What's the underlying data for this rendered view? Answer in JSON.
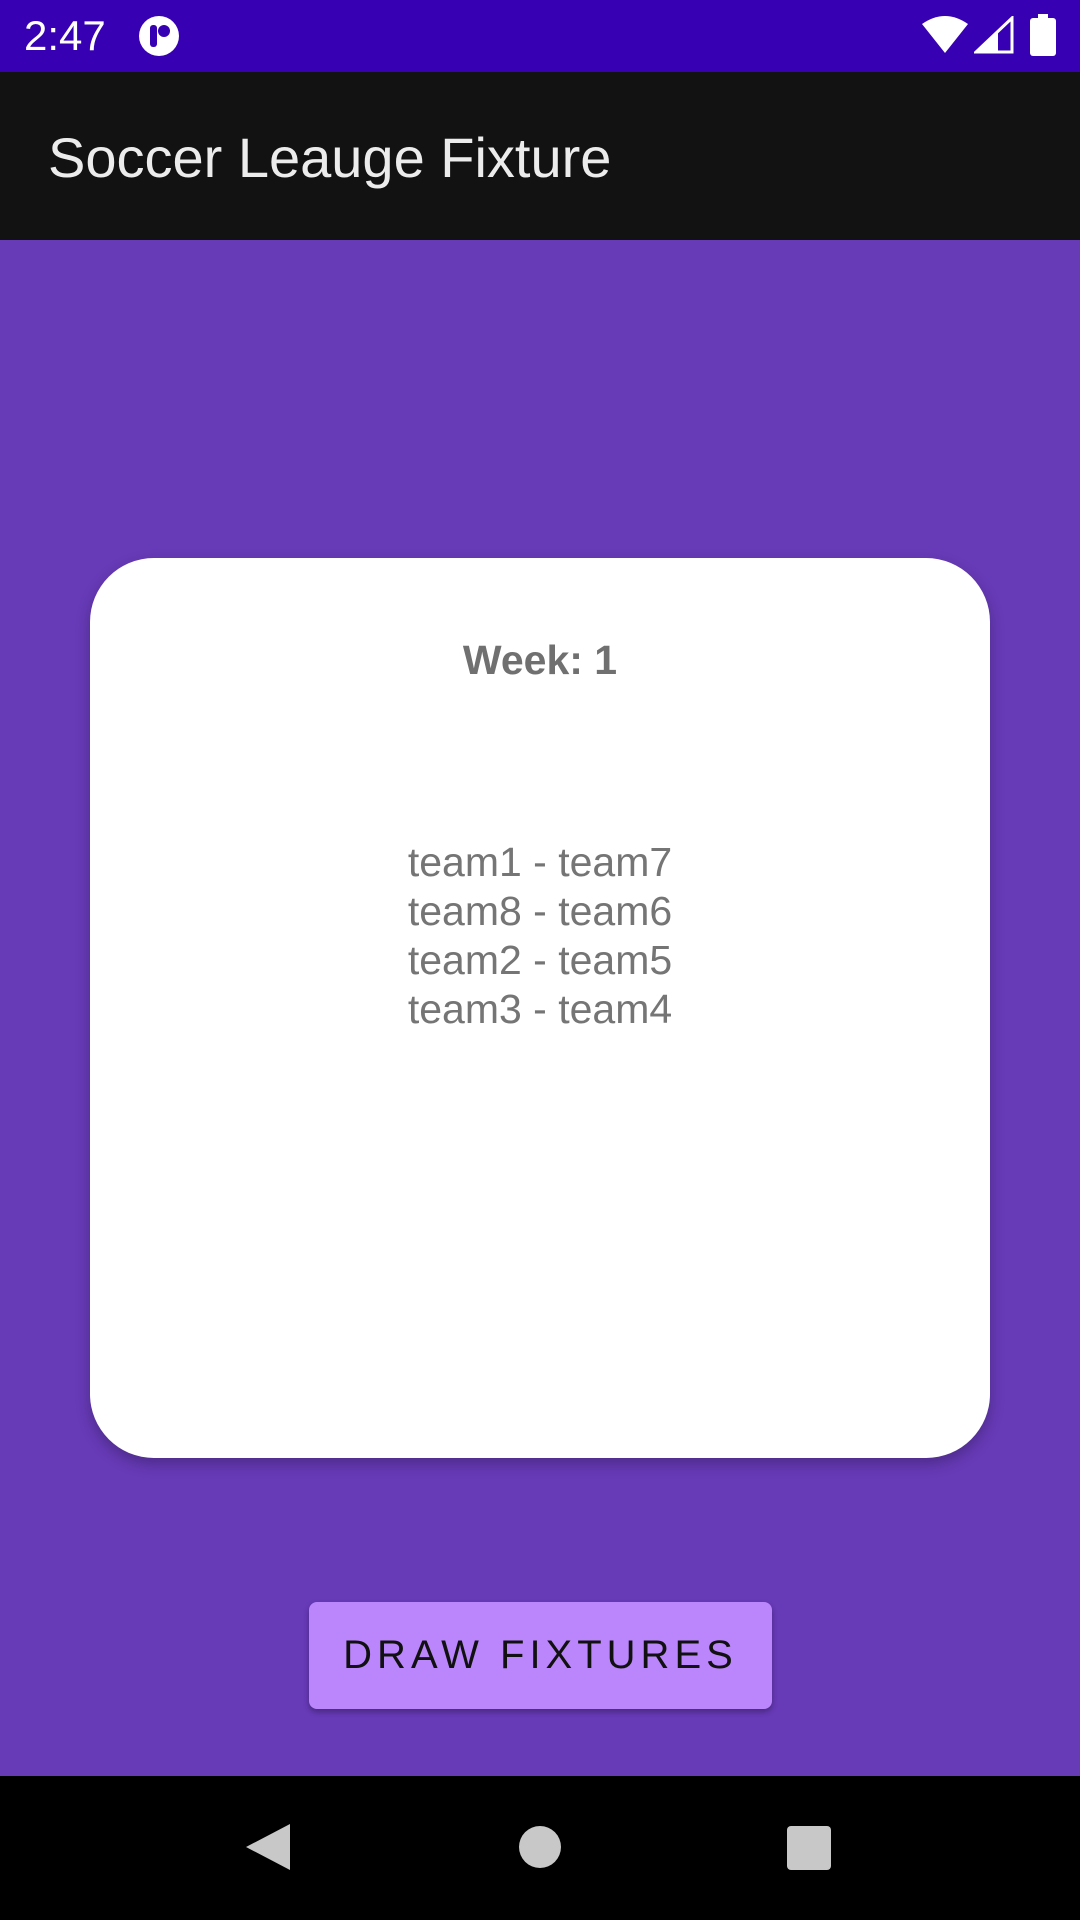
{
  "status_bar": {
    "time": "2:47",
    "icons": [
      "app-indicator-icon",
      "wifi-icon",
      "cellular-signal-icon",
      "battery-icon"
    ]
  },
  "app_bar": {
    "title": "Soccer Leauge Fixture"
  },
  "card": {
    "week_label": "Week: 1",
    "fixtures": [
      "team1 - team7",
      "team8 - team6",
      "team2 - team5",
      "team3 - team4"
    ]
  },
  "actions": {
    "draw_label": "DRAW FIXTURES"
  },
  "nav_bar": {
    "icons": [
      "back-icon",
      "home-icon",
      "recents-icon"
    ]
  },
  "colors": {
    "status_bar": "#3700b3",
    "app_bar": "#121212",
    "background": "#673ab7",
    "button": "#bb86fc",
    "card": "#ffffff"
  }
}
